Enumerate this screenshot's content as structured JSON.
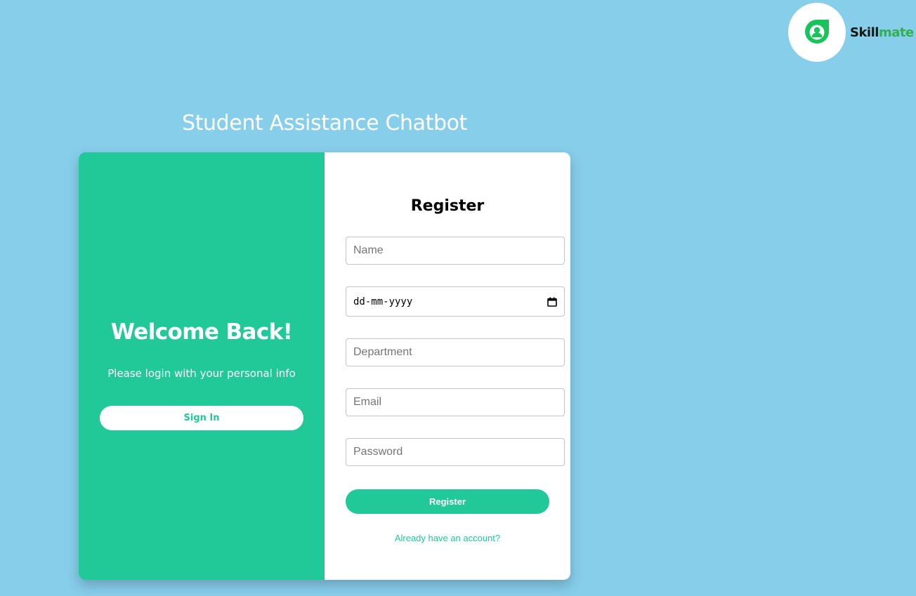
{
  "brand": {
    "name_part1": "Skill",
    "name_part2": "mate",
    "icon": "user-leaf-logo-icon",
    "logo_color": "#2fb24c"
  },
  "page_title": "Student Assistance Chatbot",
  "left_panel": {
    "heading": "Welcome Back!",
    "subtitle": "Please login with your personal info",
    "signin_label": "Sign In"
  },
  "register_form": {
    "heading": "Register",
    "fields": {
      "name_placeholder": "Name",
      "dob_format": "dd-mm-yyyy",
      "department_placeholder": "Department",
      "email_placeholder": "Email",
      "password_placeholder": "Password"
    },
    "submit_label": "Register",
    "account_link": "Already have an account?",
    "calendar_icon": "calendar-icon"
  },
  "colors": {
    "background": "#87ceeb",
    "accent": "#21c998",
    "card_right": "#ffffff"
  }
}
